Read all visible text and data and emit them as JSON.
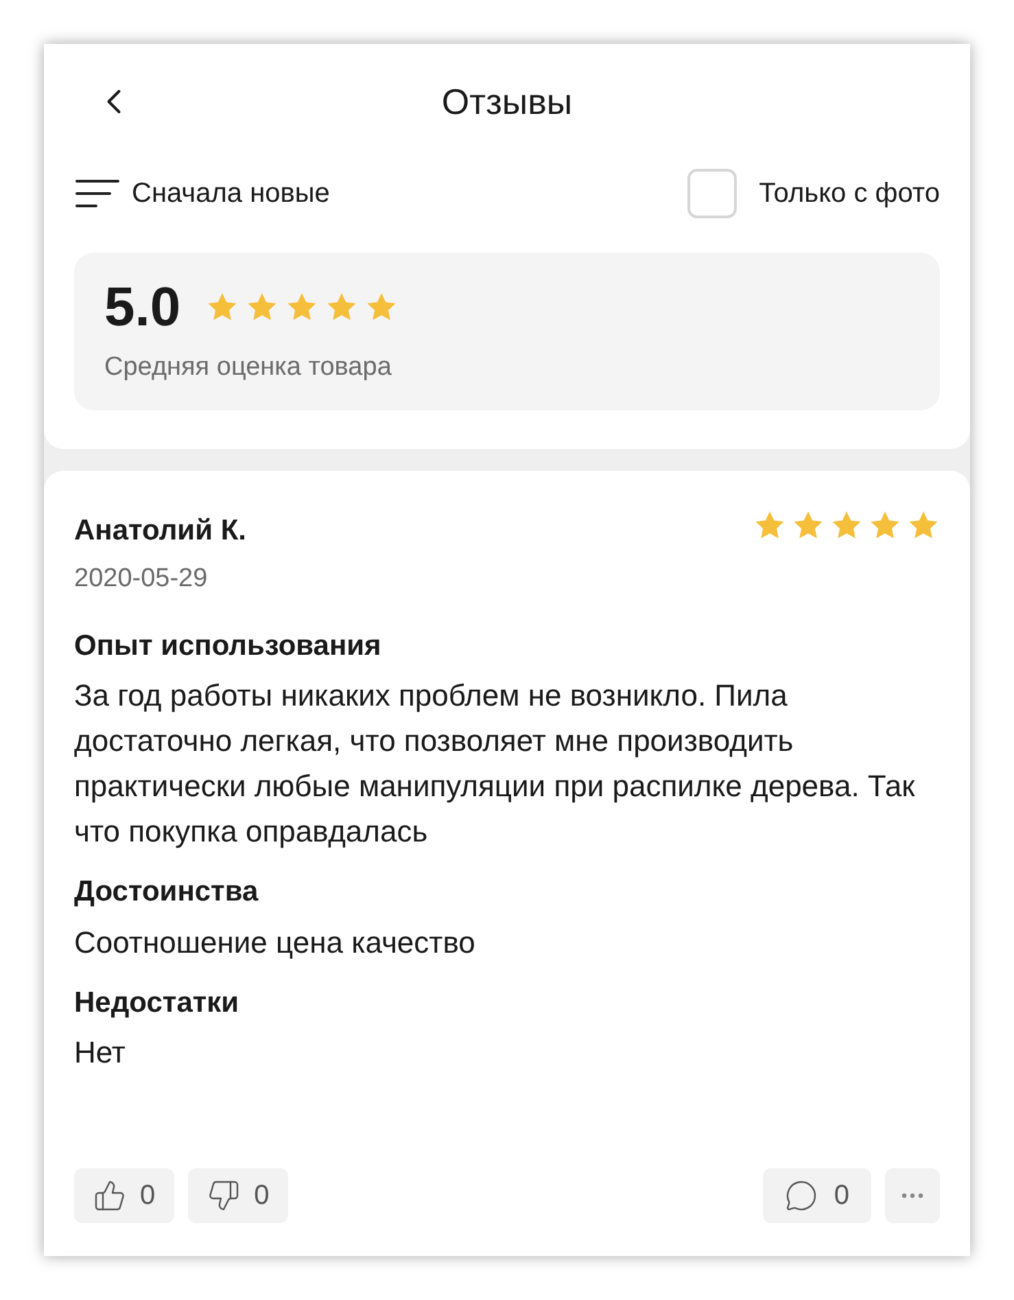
{
  "header": {
    "title": "Отзывы"
  },
  "filters": {
    "sort_label": "Сначала новые",
    "photo_only": {
      "label": "Только с фото",
      "checked": false
    }
  },
  "summary": {
    "score": "5.0",
    "stars": 5,
    "caption": "Средняя оценка товара"
  },
  "review": {
    "author": "Анатолий К.",
    "date": "2020-05-29",
    "stars": 5,
    "sections": [
      {
        "heading": "Опыт использования",
        "text": "За год работы никаких проблем не возникло. Пила достаточно легкая, что позволяет мне производить практически любые манипуляции при распилке дерева. Так что покупка оправдалась"
      },
      {
        "heading": "Достоинства",
        "text": "Соотношение цена качество"
      },
      {
        "heading": "Недостатки",
        "text": "Нет"
      }
    ],
    "likes": "0",
    "dislikes": "0",
    "comments": "0"
  }
}
